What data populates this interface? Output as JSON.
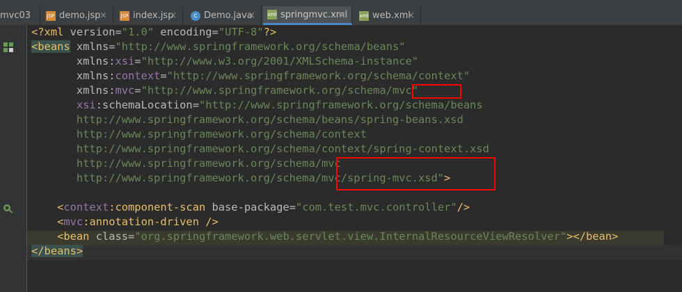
{
  "tabs": [
    {
      "label": "mvc03",
      "icon": "none"
    },
    {
      "label": "demo.jsp",
      "icon": "jsp-file-icon"
    },
    {
      "label": "index.jsp",
      "icon": "jsp-file-icon"
    },
    {
      "label": "Demo.java",
      "icon": "java-class-icon"
    },
    {
      "label": "springmvc.xml",
      "icon": "xml-file-icon",
      "active": true
    },
    {
      "label": "web.xml",
      "icon": "xml-file-icon"
    }
  ],
  "close_glyph": "×",
  "jsp_badge": "JSP",
  "java_badge": "C",
  "xml_badge": "xml",
  "code": {
    "l1": {
      "open": "<?xml ",
      "a1": "version",
      "eq1": "=",
      "v1": "\"1.0\"",
      "a2": " encoding",
      "eq2": "=",
      "v2": "\"UTF-8\"",
      "close": "?>"
    },
    "l2": {
      "lt": "<",
      "tag": "beans",
      "a": " xmlns",
      "eq": "=",
      "v": "\"http://www.springframework.org/schema/beans\""
    },
    "l3": {
      "indent": "       ",
      "a": "xmlns:",
      "ns": "xsi",
      "eq": "=",
      "v": "\"http://www.w3.org/2001/XMLSchema-instance\""
    },
    "l4": {
      "indent": "       ",
      "a": "xmlns:",
      "ns": "context",
      "eq": "=",
      "v": "\"http://www.springframework.org/schema/context\""
    },
    "l5": {
      "indent": "       ",
      "a": "xmlns:",
      "ns": "mvc",
      "eq": "=",
      "v": "\"http://www.springframework.org/schema/mvc\""
    },
    "l6": {
      "indent": "       ",
      "ns": "xsi",
      "a": ":schemaLocation",
      "eq": "=",
      "v": "\"http://www.springframework.org/schema/beans"
    },
    "l7": {
      "indent": "       ",
      "v": "http://www.springframework.org/schema/beans/spring-beans.xsd"
    },
    "l8": {
      "indent": "       ",
      "v": "http://www.springframework.org/schema/context"
    },
    "l9": {
      "indent": "       ",
      "v": "http://www.springframework.org/schema/context/spring-context.xsd"
    },
    "l10": {
      "indent": "       ",
      "v": "http://www.springframework.org/schema/mvc"
    },
    "l11": {
      "indent": "       ",
      "v": "http://www.springframework.org/schema/mvc/spring-mvc.xsd\"",
      "close": ">"
    },
    "l13": {
      "indent": "    ",
      "lt": "<",
      "ns": "context",
      "tag": ":component-scan",
      "a": " base-package",
      "eq": "=",
      "v": "\"com.test.mvc.controller\"",
      "close": "/>"
    },
    "l14": {
      "indent": "    ",
      "lt": "<",
      "ns": "mvc",
      "tag": ":annotation-driven",
      "close": " />"
    },
    "l15": {
      "indent": "    ",
      "lt": "<",
      "tag": "bean",
      "a": " class",
      "eq": "=",
      "v": "\"org.springframework.web.servlet.view.InternalResourceViewResolver\"",
      "mid": ">",
      "endtag": "</bean>"
    },
    "l16": {
      "lt": "</",
      "tag": "beans",
      "close": ">"
    }
  }
}
